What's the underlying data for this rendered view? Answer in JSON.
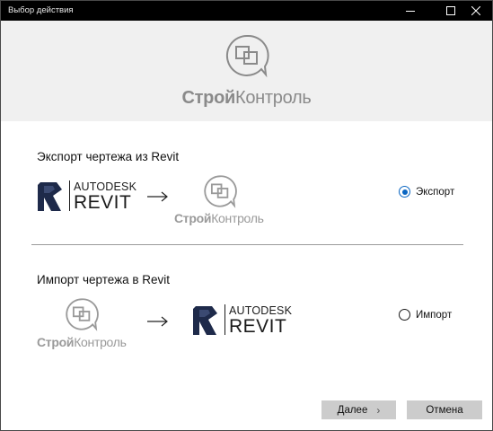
{
  "window": {
    "title": "Выбор действия"
  },
  "brand": {
    "bold": "Строй",
    "regular": "Контроль"
  },
  "export_section": {
    "title": "Экспорт чертежа из Revit",
    "radio_label": "Экспорт",
    "checked": true
  },
  "import_section": {
    "title": "Импорт чертежа в Revit",
    "radio_label": "Импорт",
    "checked": false
  },
  "autodesk": {
    "company": "AUTODESK",
    "product": "REVIT"
  },
  "buttons": {
    "next": "Далее",
    "cancel": "Отмена"
  },
  "colors": {
    "accent": "#0a66c2",
    "titlebar": "#000000",
    "header_bg": "#f0f0f0",
    "button_bg": "#cccccc",
    "revit_blue": "#1e2a4a"
  }
}
